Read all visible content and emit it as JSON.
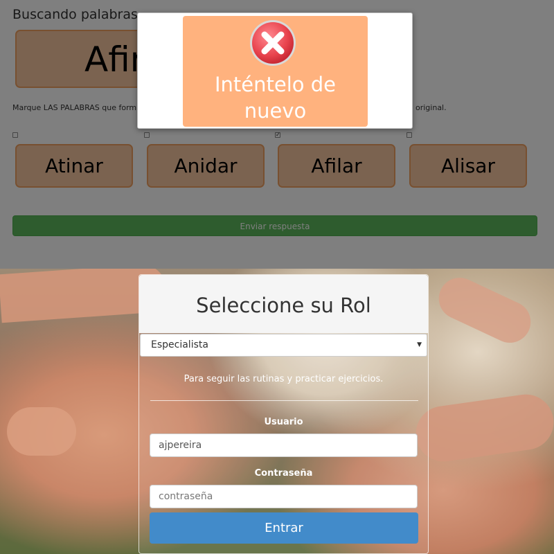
{
  "exercise": {
    "title": "Buscando palabras",
    "target_word": "Afir",
    "instruction": "Marque LAS PALABRAS que form",
    "instruction_tail": "original.",
    "options": [
      {
        "label": "Atinar",
        "checked": false
      },
      {
        "label": "Anidar",
        "checked": false
      },
      {
        "label": "Afilar",
        "checked": true
      },
      {
        "label": "Alisar",
        "checked": false
      }
    ],
    "submit_label": "Enviar respuesta",
    "colors": {
      "word_bg": "#f7c7a0",
      "word_border": "#f0a061",
      "submit": "#5cb85c"
    }
  },
  "modal": {
    "icon": "error-x-icon",
    "message": "Inténtelo de\nnuevo",
    "colors": {
      "bg": "#ffb27e",
      "icon": "#e8434d"
    }
  },
  "login": {
    "title": "Seleccione su Rol",
    "role_selected": "Especialista",
    "role_description": "Para seguir las rutinas y practicar ejercicios.",
    "username_label": "Usuario",
    "username_value": "ajpereira",
    "password_label": "Contraseña",
    "password_placeholder": "contraseña",
    "submit_label": "Entrar",
    "colors": {
      "button": "#428bca"
    }
  }
}
